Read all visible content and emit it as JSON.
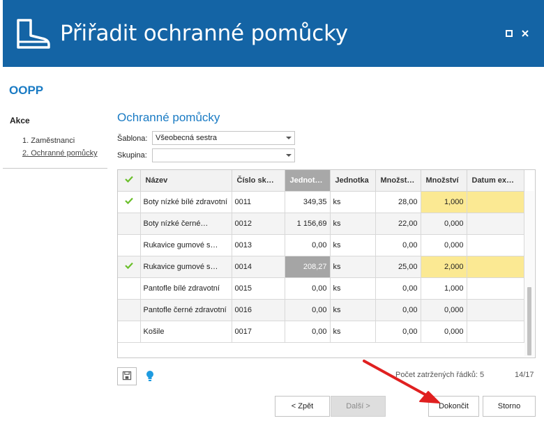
{
  "window": {
    "title": "Přiřadit ochranné pomůcky",
    "header_color": "#1464a5",
    "icon": "boot-icon"
  },
  "section_title": "OOPP",
  "sidebar": {
    "heading": "Akce",
    "steps": [
      {
        "label": "1. Zaměstnanci"
      },
      {
        "label": "2. Ochranné pomůcky"
      }
    ]
  },
  "panel": {
    "title": "Ochranné pomůcky",
    "template_label": "Šablona:",
    "template_value": "Všeobecná sestra",
    "group_label": "Skupina:",
    "group_value": ""
  },
  "grid": {
    "columns": [
      "Název",
      "Číslo sk…",
      "Jednot…",
      "Jednotka",
      "Množst…",
      "Množství",
      "Datum exp…"
    ],
    "rows": [
      {
        "checked": true,
        "name": "Boty nízké bílé zdravotní",
        "code": "0011",
        "unit_price": "349,35",
        "unit": "ks",
        "stock": "28,00",
        "qty": "1,000",
        "expiry": ""
      },
      {
        "checked": false,
        "name": "Boty nízké černé…",
        "code": "0012",
        "unit_price": "1 156,69",
        "unit": "ks",
        "stock": "22,00",
        "qty": "0,000",
        "expiry": ""
      },
      {
        "checked": false,
        "name": "Rukavice gumové s…",
        "code": "0013",
        "unit_price": "0,00",
        "unit": "ks",
        "stock": "0,00",
        "qty": "0,000",
        "expiry": ""
      },
      {
        "checked": true,
        "name": "Rukavice gumové s…",
        "code": "0014",
        "unit_price": "208,27",
        "unit": "ks",
        "stock": "25,00",
        "qty": "2,000",
        "expiry": ""
      },
      {
        "checked": false,
        "name": "Pantofle bílé zdravotní",
        "code": "0015",
        "unit_price": "0,00",
        "unit": "ks",
        "stock": "0,00",
        "qty": "1,000",
        "expiry": ""
      },
      {
        "checked": false,
        "name": "Pantofle černé zdravotní",
        "code": "0016",
        "unit_price": "0,00",
        "unit": "ks",
        "stock": "0,00",
        "qty": "0,000",
        "expiry": ""
      },
      {
        "checked": false,
        "name": "Košile",
        "code": "0017",
        "unit_price": "0,00",
        "unit": "ks",
        "stock": "0,00",
        "qty": "0,000",
        "expiry": ""
      }
    ],
    "highlight_color": "#fbe993",
    "check_color": "#6abf2a"
  },
  "footer": {
    "row_count": "Počet zatržených řádků: 5",
    "page_count": "14/17"
  },
  "buttons": {
    "back": "< Zpět",
    "next": "Další >",
    "finish": "Dokončit",
    "cancel": "Storno"
  },
  "annotation_color": "#e02020"
}
